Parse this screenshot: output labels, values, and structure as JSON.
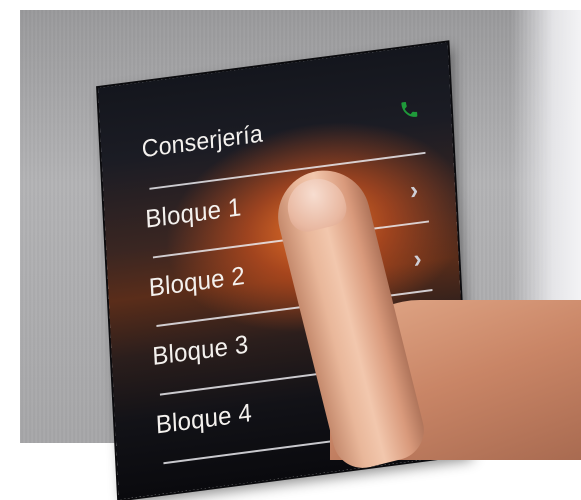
{
  "intercom": {
    "header": {
      "label": "Conserjería",
      "icon": "phone-icon",
      "icon_color": "#1f9a3a"
    },
    "items": [
      {
        "label": "Bloque 1",
        "icon": "chevron-right-icon"
      },
      {
        "label": "Bloque 2",
        "icon": "chevron-right-icon"
      },
      {
        "label": "Bloque 3",
        "icon": "chevron-right-icon"
      },
      {
        "label": "Bloque 4",
        "icon": "chevron-right-icon"
      }
    ]
  }
}
